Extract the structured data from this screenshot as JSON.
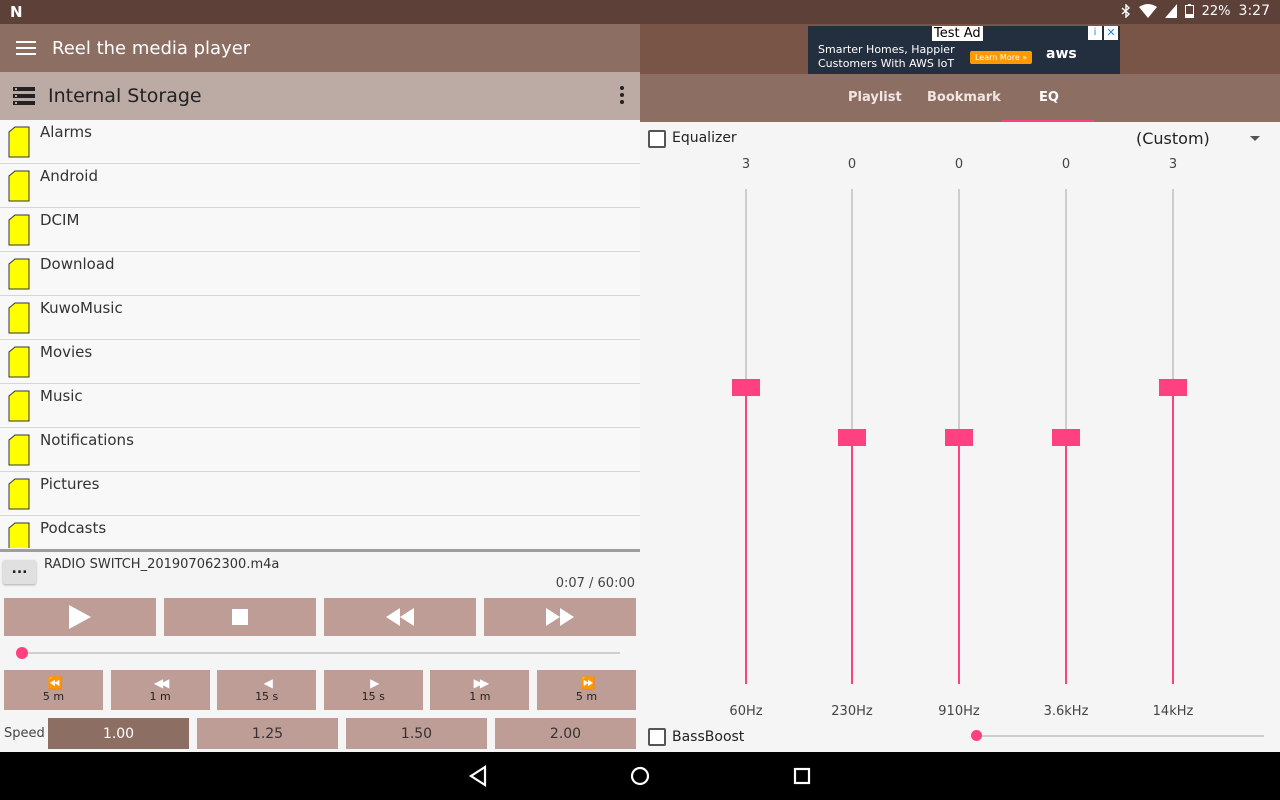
{
  "status_bar": {
    "battery": "22%",
    "time": "3:27",
    "logo": "N"
  },
  "app": {
    "title": "Reel the media player"
  },
  "browser": {
    "location": "Internal Storage",
    "folders": [
      "Alarms",
      "Android",
      "DCIM",
      "Download",
      "KuwoMusic",
      "Movies",
      "Music",
      "Notifications",
      "Pictures",
      "Podcasts"
    ]
  },
  "player": {
    "more_label": "...",
    "track": "RADIO SWITCH_201907062300.m4a",
    "time": "0:07 / 60:00",
    "progress": 0.002,
    "skip_buttons": [
      {
        "glyph": "⏪",
        "label": "5 m"
      },
      {
        "glyph": "◀◀",
        "label": "1 m"
      },
      {
        "glyph": "◀",
        "label": "15 s"
      },
      {
        "glyph": "▶",
        "label": "15 s"
      },
      {
        "glyph": "▶▶",
        "label": "1 m"
      },
      {
        "glyph": "⏩",
        "label": "5 m"
      }
    ],
    "speed_label": "Speed",
    "speeds": [
      "1.00",
      "1.25",
      "1.50",
      "2.00"
    ],
    "selected_speed": "1.00"
  },
  "ad": {
    "tag": "Test Ad",
    "line1": "Smarter Homes, Happier",
    "line2": "Customers With AWS IoT",
    "cta": "Learn More »",
    "brand": "aws",
    "info": "i",
    "close": "✕"
  },
  "tabs": {
    "items": [
      "Playlist",
      "Bookmark",
      "EQ"
    ],
    "active": "EQ"
  },
  "equalizer": {
    "label": "Equalizer",
    "enabled": false,
    "preset": "(Custom)",
    "bands": [
      {
        "freq": "60Hz",
        "value": "3"
      },
      {
        "freq": "230Hz",
        "value": "0"
      },
      {
        "freq": "910Hz",
        "value": "0"
      },
      {
        "freq": "3.6kHz",
        "value": "0"
      },
      {
        "freq": "14kHz",
        "value": "3"
      }
    ],
    "range_min": -15,
    "range_max": 15,
    "bass_label": "BassBoost",
    "bass_enabled": false,
    "bass_level": 0
  },
  "colors": {
    "accent": "#ff4081",
    "primary": "#8d6e63",
    "primary_dark": "#5d4037",
    "button": "#bd9d96",
    "folder": "#ffff00"
  }
}
